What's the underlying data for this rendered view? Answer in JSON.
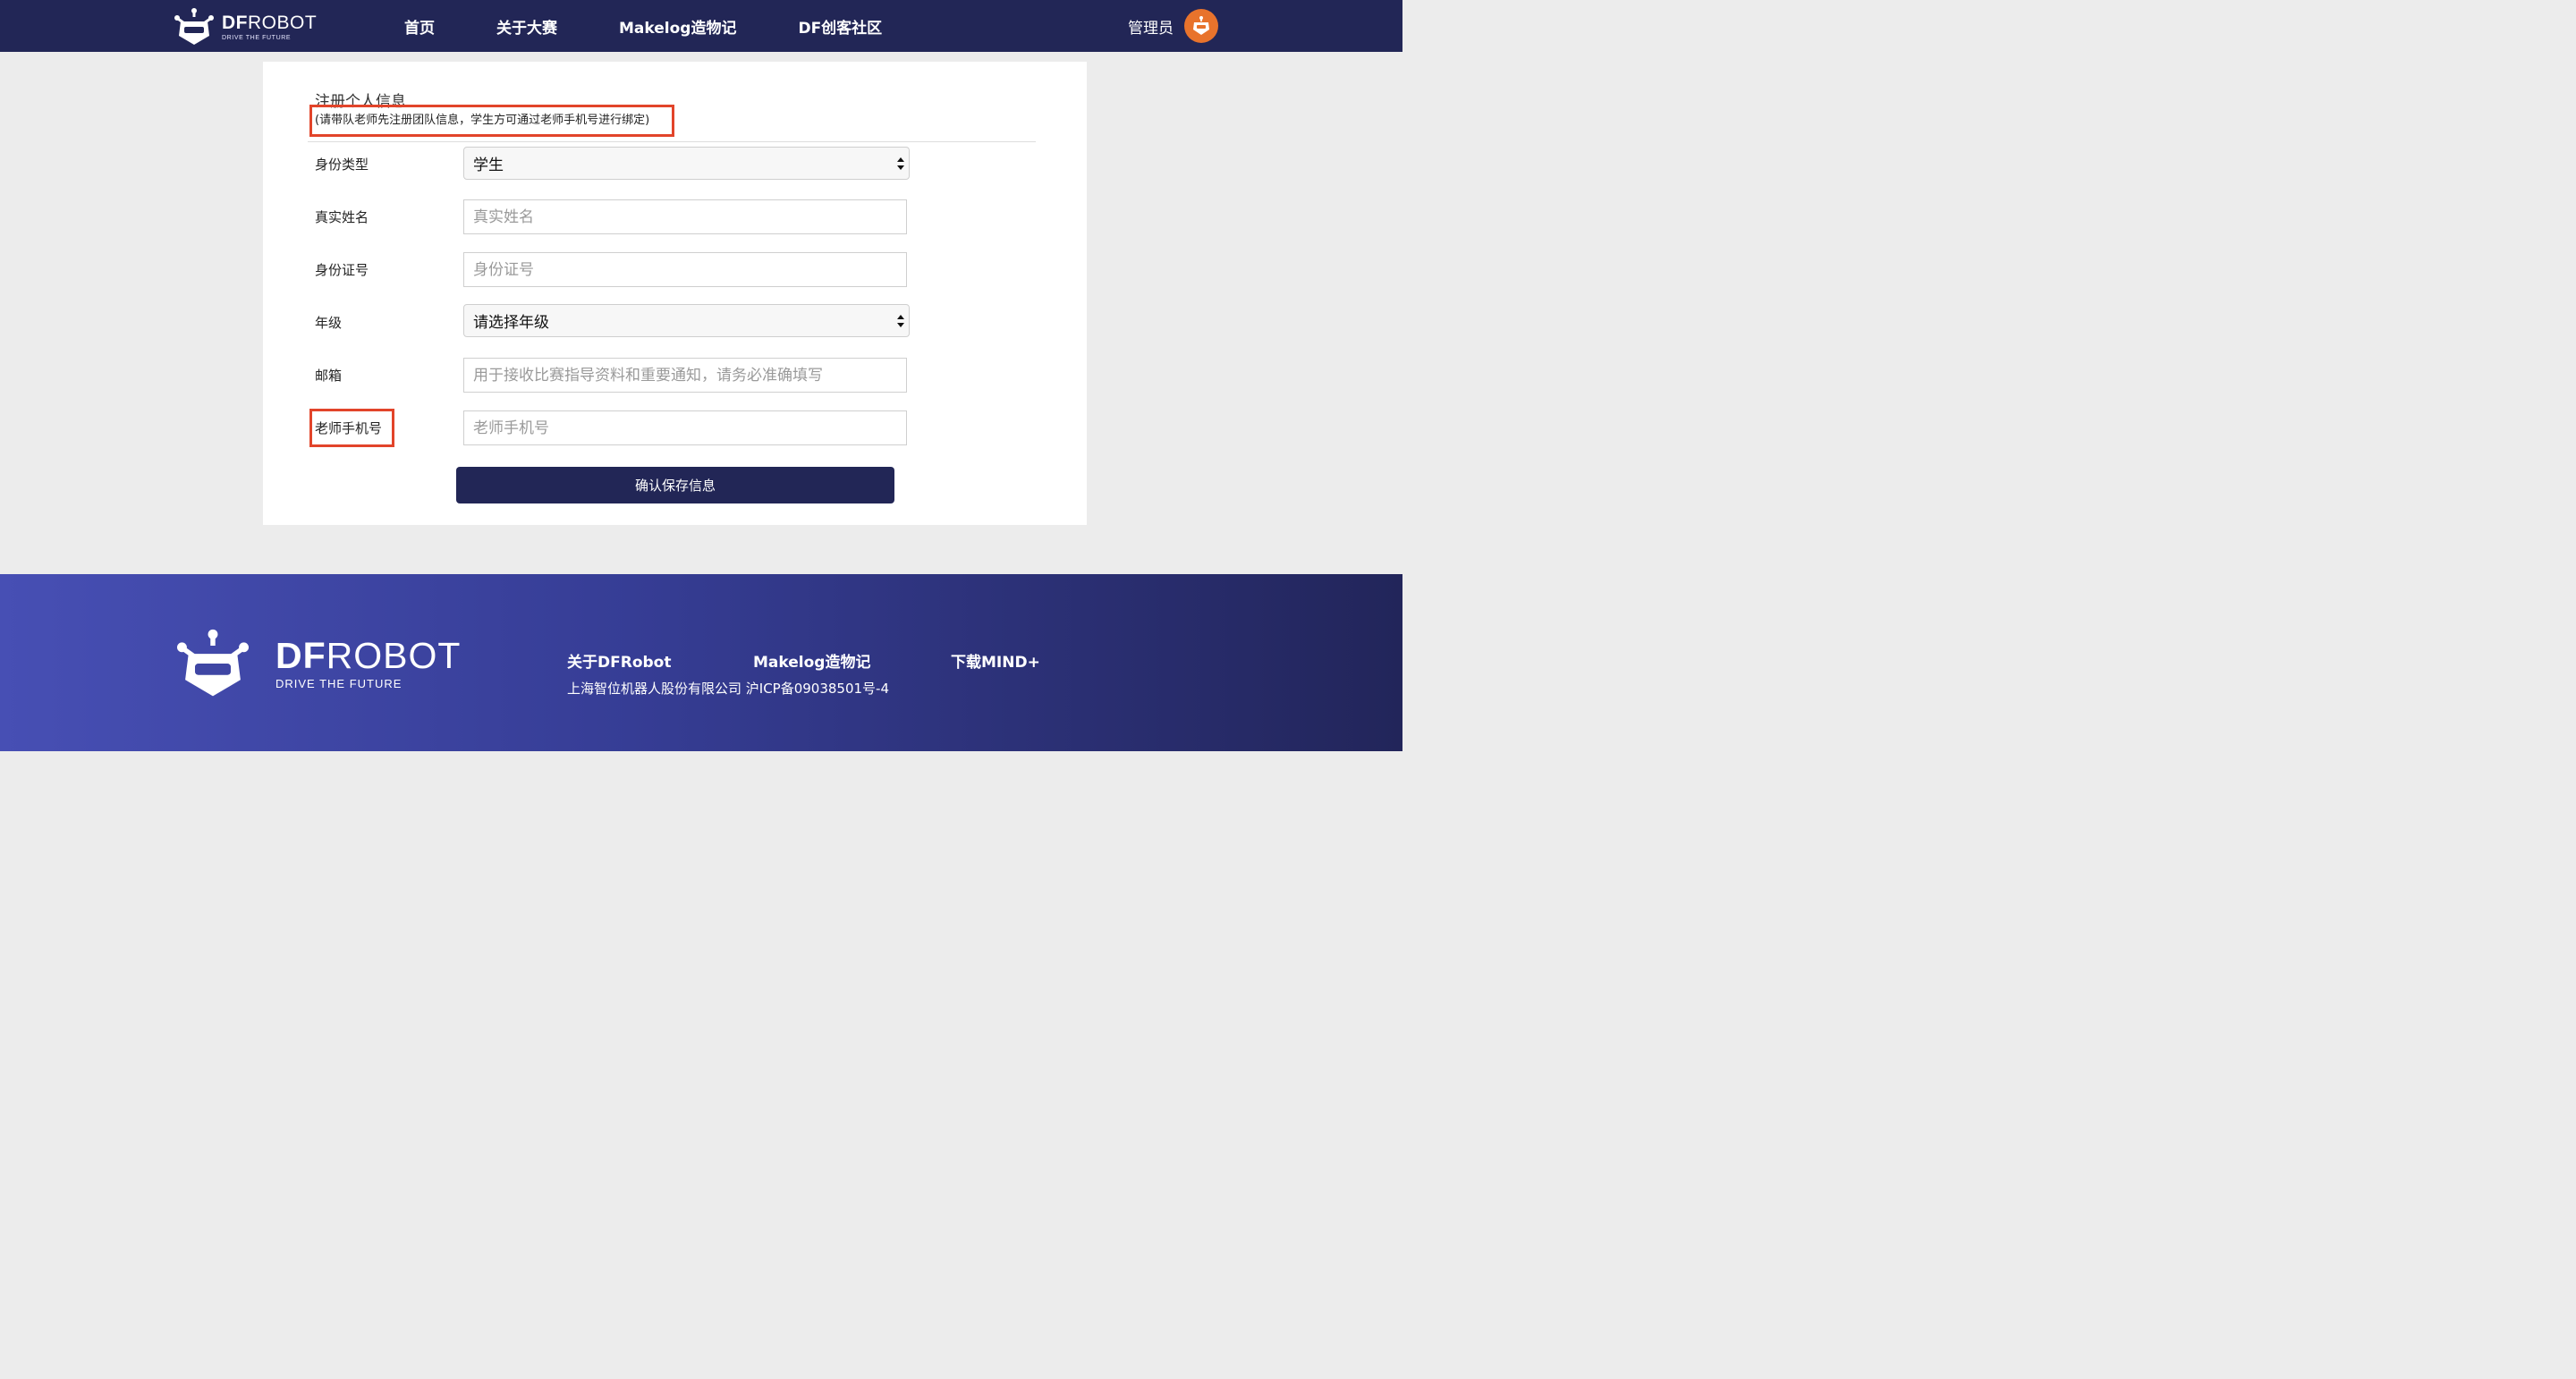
{
  "header": {
    "logo": {
      "brand_bold": "DF",
      "brand_rest": "ROBOT",
      "tagline": "DRIVE THE FUTURE"
    },
    "nav": [
      {
        "label": "首页"
      },
      {
        "label": "关于大赛"
      },
      {
        "label": "Makelog造物记"
      },
      {
        "label": "DF创客社区"
      }
    ],
    "user": {
      "name": "管理员",
      "avatar_icon": "robot-avatar-icon"
    }
  },
  "form": {
    "title": "注册个人信息",
    "notice": "(请带队老师先注册团队信息，学生方可通过老师手机号进行绑定)",
    "fields": {
      "identity": {
        "label": "身份类型",
        "value": "学生"
      },
      "real_name": {
        "label": "真实姓名",
        "placeholder": "真实姓名",
        "value": ""
      },
      "id_number": {
        "label": "身份证号",
        "placeholder": "身份证号",
        "value": ""
      },
      "grade": {
        "label": "年级",
        "value": "请选择年级"
      },
      "email": {
        "label": "邮箱",
        "placeholder": "用于接收比赛指导资料和重要通知，请务必准确填写",
        "value": ""
      },
      "teacher_phone": {
        "label": "老师手机号",
        "placeholder": "老师手机号",
        "value": ""
      }
    },
    "submit_label": "确认保存信息"
  },
  "footer": {
    "logo": {
      "brand_bold": "DF",
      "brand_rest": "ROBOT",
      "tagline": "DRIVE THE FUTURE"
    },
    "links": [
      {
        "label": "关于DFRobot"
      },
      {
        "label": "Makelog造物记"
      },
      {
        "label": "下载MIND+"
      }
    ],
    "copyright": "上海智位机器人股份有限公司 沪ICP备09038501号-4"
  },
  "colors": {
    "brand_navy": "#222656",
    "highlight_red": "#e2442a",
    "avatar_orange": "#e8732c"
  }
}
